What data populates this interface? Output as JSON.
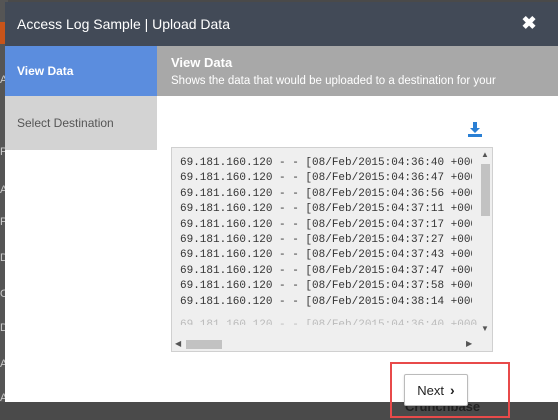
{
  "window": {
    "title": "Access Log Sample | Upload Data",
    "close_glyph": "✖"
  },
  "sidebar": {
    "items": [
      {
        "label": "View Data",
        "active": true
      },
      {
        "label": "Select Destination",
        "active": false
      }
    ]
  },
  "main": {
    "title": "View Data",
    "subtitle": "Shows the data that would be uploaded to a destination for your",
    "download_icon": "download-icon",
    "log_lines": [
      "69.181.160.120 - - [08/Feb/2015:04:36:40 +000",
      "69.181.160.120 - - [08/Feb/2015:04:36:47 +000",
      "69.181.160.120 - - [08/Feb/2015:04:36:56 +000",
      "69.181.160.120 - - [08/Feb/2015:04:37:11 +000",
      "69.181.160.120 - - [08/Feb/2015:04:37:17 +000",
      "69.181.160.120 - - [08/Feb/2015:04:37:27 +000",
      "69.181.160.120 - - [08/Feb/2015:04:37:43 +000",
      "69.181.160.120 - - [08/Feb/2015:04:37:47 +000",
      "69.181.160.120 - - [08/Feb/2015:04:37:58 +000",
      "69.181.160.120 - - [08/Feb/2015:04:38:14 +000"
    ],
    "next_label": "Next"
  },
  "background": {
    "crunchbase_text": "Crunchbase",
    "left_letters": [
      "A",
      "Pl",
      "A",
      "Pl",
      "Da",
      "Or",
      "D",
      "Az",
      "Av"
    ]
  },
  "colors": {
    "titlebar": "#424a57",
    "active_nav": "#5b8dde",
    "highlight": "#e84a4a",
    "download": "#2a7fd4"
  }
}
